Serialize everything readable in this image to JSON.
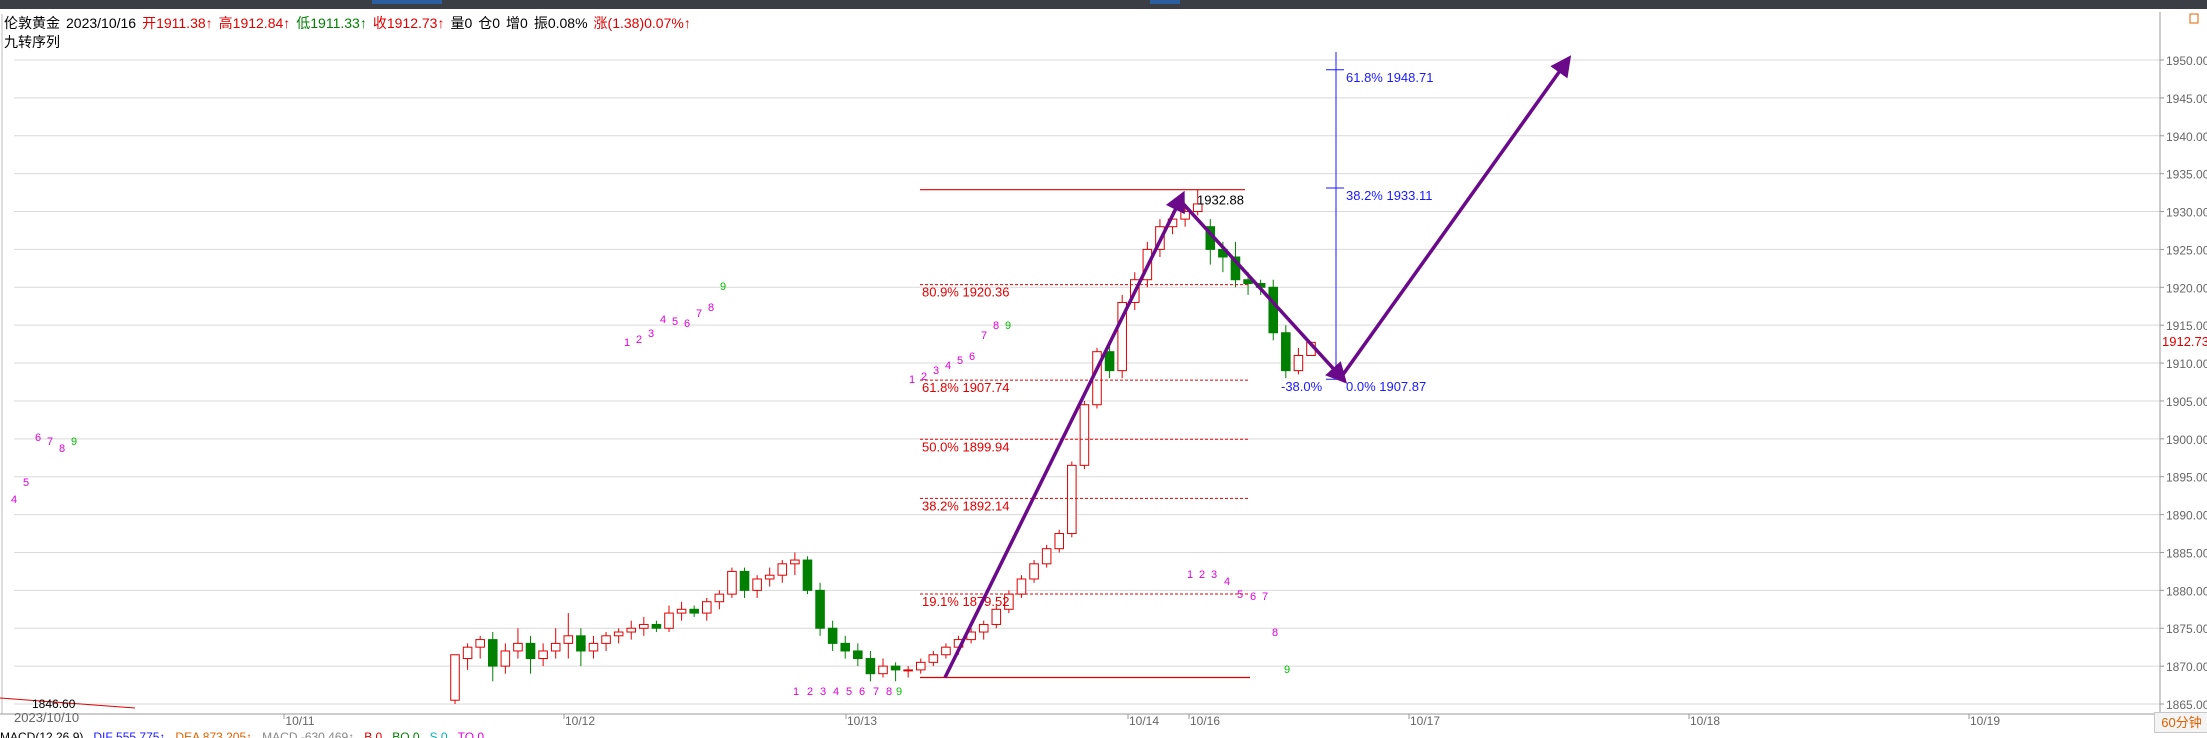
{
  "header": {
    "name": "伦敦黄金",
    "date": "2023/10/16",
    "open": "开1911.38↑",
    "high": "高1912.84↑",
    "low": "低1911.33↑",
    "close": "收1912.73↑",
    "volume": "量0",
    "position": "仓0",
    "increase": "增0",
    "amplitude": "振0.08%",
    "change": "涨(1.38)0.07%↑"
  },
  "indicator_label": "九转序列",
  "last_price": "1912.73",
  "period_button": "60分钟",
  "first_date": "2023/10/10",
  "low_marker": "1846.60",
  "bottom": {
    "macd_name": "MACD(12,26,9)",
    "dif": "DIF 555.775↑",
    "dea": "DEA 873.205↑",
    "macd": "MACD -630.469↑",
    "extra1": "B 0",
    "extra2": "BO 0",
    "extra3": "S 0",
    "extra4": "TO 0"
  },
  "colors": {
    "up": "#e00000",
    "down": "#008000",
    "arrow": "#6a0a8a",
    "fib_blue": "#1a1aff",
    "fib_red": "#e00000",
    "seq_magenta": "#e000e0",
    "seq_green": "#00c000"
  },
  "chart_data": {
    "type": "candlestick",
    "y_axis": {
      "min": 1865,
      "max": 1950,
      "ticks": [
        "1865.00",
        "1870.00",
        "1875.00",
        "1880.00",
        "1885.00",
        "1890.00",
        "1895.00",
        "1900.00",
        "1905.00",
        "1910.00",
        "1915.00",
        "1920.00",
        "1925.00",
        "1930.00",
        "1935.00",
        "1940.00",
        "1945.00",
        "1950.00"
      ]
    },
    "x_labels": [
      "10/11",
      "10/12",
      "10/13",
      "10/14",
      "10/16",
      "10/17",
      "10/18",
      "10/19"
    ],
    "candles": [
      [
        1865.5,
        1871,
        1865,
        1871.5
      ],
      [
        1871,
        1873,
        1869.5,
        1872.5
      ],
      [
        1872.5,
        1874,
        1871,
        1873.5
      ],
      [
        1873.5,
        1874.5,
        1868,
        1870
      ],
      [
        1870,
        1873,
        1869,
        1872
      ],
      [
        1872,
        1875,
        1871,
        1873
      ],
      [
        1873,
        1874,
        1869,
        1871
      ],
      [
        1871,
        1873,
        1870,
        1872
      ],
      [
        1872,
        1875,
        1871,
        1873
      ],
      [
        1873,
        1877,
        1871,
        1874
      ],
      [
        1874,
        1875,
        1870,
        1872
      ],
      [
        1872,
        1874,
        1871,
        1873
      ],
      [
        1873,
        1874.5,
        1872,
        1874
      ],
      [
        1874,
        1875,
        1873,
        1874.5
      ],
      [
        1874.5,
        1876,
        1873.5,
        1875
      ],
      [
        1875,
        1876.5,
        1874,
        1875.5
      ],
      [
        1875.5,
        1876,
        1874.5,
        1875
      ],
      [
        1875,
        1878,
        1874.5,
        1877
      ],
      [
        1877,
        1878.5,
        1876,
        1877.5
      ],
      [
        1877.5,
        1878,
        1876.5,
        1877
      ],
      [
        1877,
        1879,
        1876,
        1878.5
      ],
      [
        1878.5,
        1880,
        1877.5,
        1879.5
      ],
      [
        1879.5,
        1883,
        1879,
        1882.5
      ],
      [
        1882.5,
        1883,
        1879,
        1880
      ],
      [
        1880,
        1882,
        1879,
        1881.5
      ],
      [
        1881.5,
        1883,
        1880.5,
        1882
      ],
      [
        1882,
        1884,
        1881,
        1883.5
      ],
      [
        1883.5,
        1885,
        1882,
        1884
      ],
      [
        1884,
        1884.5,
        1879.5,
        1880
      ],
      [
        1880,
        1881,
        1874,
        1875
      ],
      [
        1875,
        1876,
        1872,
        1873
      ],
      [
        1873,
        1874,
        1871,
        1872
      ],
      [
        1872,
        1873,
        1870,
        1871
      ],
      [
        1871,
        1872,
        1868,
        1869
      ],
      [
        1869,
        1871,
        1868.5,
        1870
      ],
      [
        1870,
        1870.5,
        1868,
        1869.5
      ],
      [
        1869.5,
        1870,
        1868.5,
        1869.5
      ],
      [
        1869.5,
        1871,
        1869,
        1870.5
      ],
      [
        1870.5,
        1872,
        1870,
        1871.5
      ],
      [
        1871.5,
        1873,
        1871,
        1872.5
      ],
      [
        1872.5,
        1874,
        1871.5,
        1873.5
      ],
      [
        1873.5,
        1875,
        1873,
        1874.5
      ],
      [
        1874.5,
        1876,
        1873.5,
        1875.5
      ],
      [
        1875.5,
        1878,
        1875,
        1877.5
      ],
      [
        1877.5,
        1880,
        1877,
        1879.5
      ],
      [
        1879.5,
        1882,
        1879,
        1881.5
      ],
      [
        1881.5,
        1884,
        1881,
        1883.5
      ],
      [
        1883.5,
        1886,
        1883,
        1885.5
      ],
      [
        1885.5,
        1888,
        1885,
        1887.5
      ],
      [
        1887.5,
        1897,
        1887,
        1896.5
      ],
      [
        1896.5,
        1905,
        1896,
        1904.5
      ],
      [
        1904.5,
        1912,
        1904,
        1911.5
      ],
      [
        1911.5,
        1913,
        1908,
        1909
      ],
      [
        1909,
        1919,
        1908,
        1918
      ],
      [
        1918,
        1922,
        1917,
        1921
      ],
      [
        1921,
        1926,
        1920,
        1925
      ],
      [
        1925,
        1929,
        1924,
        1928
      ],
      [
        1928,
        1930,
        1927,
        1929
      ],
      [
        1929,
        1931,
        1928,
        1930
      ],
      [
        1930,
        1932.88,
        1929.5,
        1931
      ],
      [
        1928,
        1929,
        1923,
        1925
      ],
      [
        1925,
        1926,
        1922,
        1924
      ],
      [
        1924,
        1926,
        1920,
        1921
      ],
      [
        1921,
        1922,
        1919,
        1920.5
      ],
      [
        1920.5,
        1921,
        1919,
        1920
      ],
      [
        1920,
        1921,
        1913,
        1914
      ],
      [
        1914,
        1915,
        1908,
        1909
      ],
      [
        1909,
        1912,
        1908.5,
        1911
      ],
      [
        1911,
        1912.84,
        1911,
        1912.73
      ]
    ],
    "fibonacci_retracement": [
      {
        "label": "80.9% 1920.36",
        "value": 1920.36
      },
      {
        "label": "61.8% 1907.74",
        "value": 1907.74
      },
      {
        "label": "50.0% 1899.94",
        "value": 1899.94
      },
      {
        "label": "38.2% 1892.14",
        "value": 1892.14
      },
      {
        "label": "19.1% 1879.52",
        "value": 1879.52
      }
    ],
    "fibonacci_extension": [
      {
        "label": "61.8% 1948.71",
        "value": 1948.71
      },
      {
        "label": "38.2% 1933.11",
        "value": 1933.11
      },
      {
        "label": "0.0% 1907.87",
        "value": 1907.87
      },
      {
        "label": "-38.0%",
        "value": 1907.87
      }
    ],
    "high_label": "1932.88",
    "high_value": 1932.88,
    "low_level": 1868.5,
    "sequence_counts": [
      {
        "n": "4",
        "green": false
      },
      {
        "n": "5",
        "green": false
      },
      {
        "n": "6",
        "green": false
      },
      {
        "n": "7",
        "green": false
      },
      {
        "n": "8",
        "green": false
      },
      {
        "n": "9",
        "green": true
      },
      {
        "n": "1",
        "green": false
      },
      {
        "n": "2",
        "green": false
      },
      {
        "n": "3",
        "green": false
      },
      {
        "n": "4",
        "green": false
      },
      {
        "n": "5",
        "green": false
      },
      {
        "n": "6",
        "green": false
      },
      {
        "n": "7",
        "green": false
      },
      {
        "n": "8",
        "green": false
      },
      {
        "n": "9",
        "green": true
      },
      {
        "n": "1",
        "green": false
      },
      {
        "n": "2",
        "green": false
      },
      {
        "n": "3",
        "green": false
      },
      {
        "n": "4",
        "green": false
      },
      {
        "n": "5",
        "green": false
      },
      {
        "n": "6",
        "green": false
      },
      {
        "n": "7",
        "green": false
      },
      {
        "n": "8",
        "green": false
      },
      {
        "n": "9",
        "green": true
      },
      {
        "n": "1",
        "green": false
      },
      {
        "n": "2",
        "green": false
      },
      {
        "n": "3",
        "green": false
      },
      {
        "n": "4",
        "green": false
      },
      {
        "n": "5",
        "green": false
      },
      {
        "n": "6",
        "green": false
      },
      {
        "n": "7",
        "green": false
      },
      {
        "n": "8",
        "green": false
      },
      {
        "n": "9",
        "green": true
      },
      {
        "n": "1",
        "green": false
      },
      {
        "n": "2",
        "green": false
      },
      {
        "n": "3",
        "green": false
      },
      {
        "n": "4",
        "green": false
      },
      {
        "n": "5",
        "green": false
      },
      {
        "n": "6",
        "green": false
      },
      {
        "n": "7",
        "green": false
      },
      {
        "n": "8",
        "green": false
      },
      {
        "n": "9",
        "green": true
      }
    ]
  }
}
